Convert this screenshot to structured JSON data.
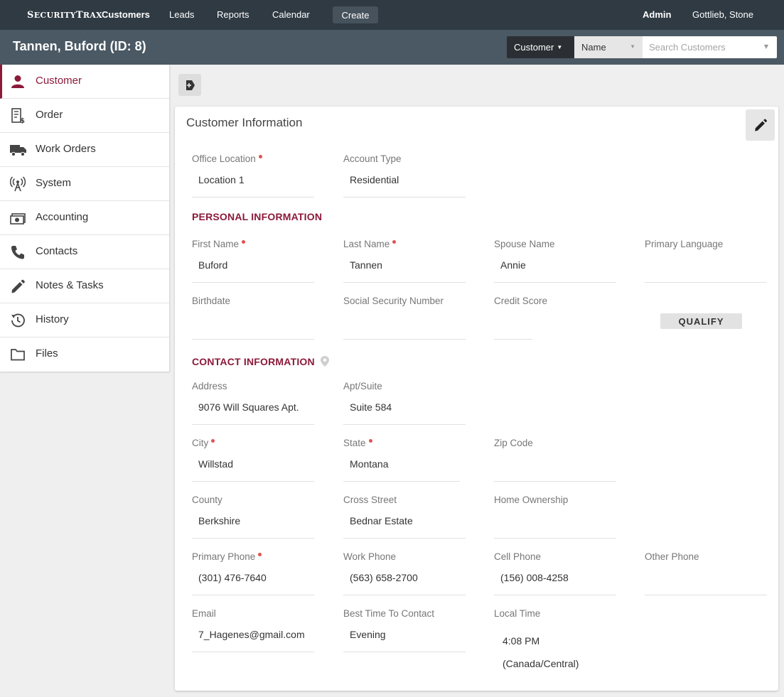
{
  "nav": {
    "brand_prefix": "S",
    "brand_mid": "ECURITY",
    "brand_t": "T",
    "brand_suffix": "RAX",
    "links": [
      "Customers",
      "Leads",
      "Reports",
      "Calendar"
    ],
    "create": "Create",
    "admin": "Admin",
    "user": "Gottlieb, Stone"
  },
  "header": {
    "title": "Tannen, Buford (ID: 8)",
    "search_type": "Customer",
    "search_field": "Name",
    "search_placeholder": "Search Customers"
  },
  "sidebar": {
    "items": [
      {
        "label": "Customer",
        "icon": "person-icon"
      },
      {
        "label": "Order",
        "icon": "receipt-icon"
      },
      {
        "label": "Work Orders",
        "icon": "truck-icon"
      },
      {
        "label": "System",
        "icon": "antenna-icon"
      },
      {
        "label": "Accounting",
        "icon": "money-icon"
      },
      {
        "label": "Contacts",
        "icon": "phone-icon"
      },
      {
        "label": "Notes & Tasks",
        "icon": "pencil-icon"
      },
      {
        "label": "History",
        "icon": "clock-icon"
      },
      {
        "label": "Files",
        "icon": "folder-icon"
      }
    ]
  },
  "card": {
    "title": "Customer Information",
    "office_location": {
      "label": "Office Location",
      "value": "Location 1"
    },
    "account_type": {
      "label": "Account Type",
      "value": "Residential"
    },
    "personal_heading": "PERSONAL INFORMATION",
    "first_name": {
      "label": "First Name",
      "value": "Buford"
    },
    "last_name": {
      "label": "Last Name",
      "value": "Tannen"
    },
    "spouse_name": {
      "label": "Spouse Name",
      "value": "Annie"
    },
    "primary_language": {
      "label": "Primary Language",
      "value": ""
    },
    "birthdate": {
      "label": "Birthdate",
      "value": ""
    },
    "ssn": {
      "label": "Social Security Number",
      "value": ""
    },
    "credit_score": {
      "label": "Credit Score",
      "value": ""
    },
    "qualify": "QUALIFY",
    "contact_heading": "CONTACT INFORMATION",
    "address": {
      "label": "Address",
      "value": "9076 Will Squares Apt."
    },
    "apt": {
      "label": "Apt/Suite",
      "value": "Suite 584"
    },
    "city": {
      "label": "City",
      "value": "Willstad"
    },
    "state": {
      "label": "State",
      "value": "Montana"
    },
    "zip": {
      "label": "Zip Code",
      "value": ""
    },
    "county": {
      "label": "County",
      "value": "Berkshire"
    },
    "cross_street": {
      "label": "Cross Street",
      "value": "Bednar Estate"
    },
    "home_ownership": {
      "label": "Home Ownership",
      "value": ""
    },
    "primary_phone": {
      "label": "Primary Phone",
      "value": "(301) 476-7640"
    },
    "work_phone": {
      "label": "Work Phone",
      "value": "(563) 658-2700"
    },
    "cell_phone": {
      "label": "Cell Phone",
      "value": "(156) 008-4258"
    },
    "other_phone": {
      "label": "Other Phone",
      "value": ""
    },
    "email": {
      "label": "Email",
      "value": "7_Hagenes@gmail.com"
    },
    "best_time": {
      "label": "Best Time To Contact",
      "value": "Evening"
    },
    "local_time": {
      "label": "Local Time",
      "time": "4:08 PM",
      "zone": "(Canada/Central)"
    }
  },
  "colors": {
    "accent": "#8b1a3a",
    "topnav": "#2f3a43",
    "headerbar": "#4a5964"
  }
}
